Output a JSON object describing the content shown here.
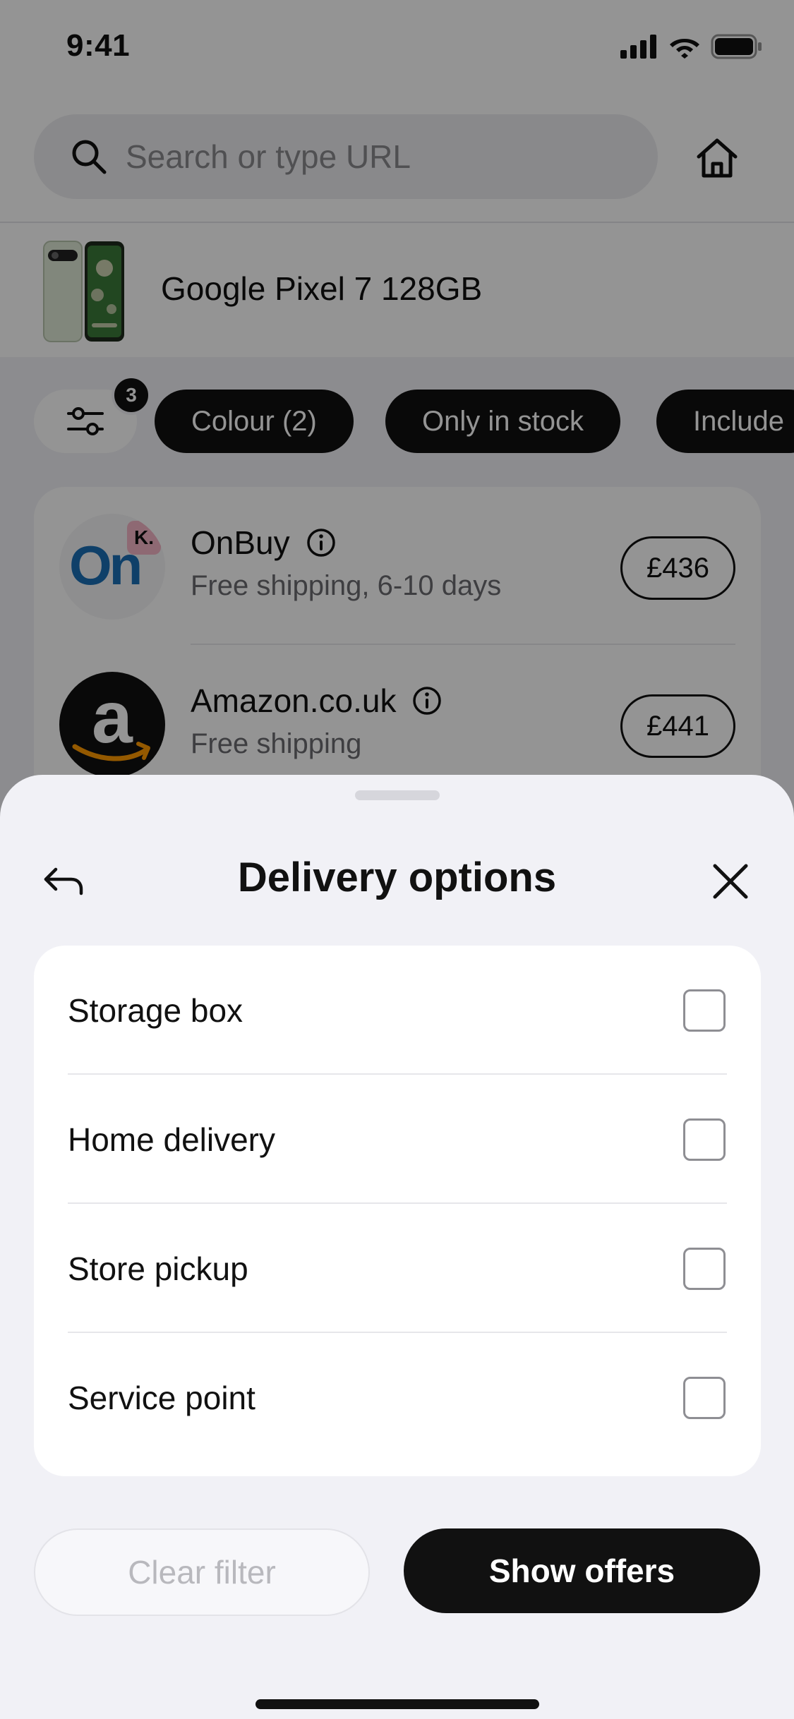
{
  "status_bar": {
    "time": "9:41"
  },
  "search": {
    "placeholder": "Search or type URL"
  },
  "product": {
    "title": "Google Pixel 7 128GB"
  },
  "filters": {
    "badge_count": "3",
    "chips": [
      "Colour (2)",
      "Only in stock",
      "Include"
    ]
  },
  "offers": [
    {
      "store": "OnBuy",
      "shipping": "Free shipping, 6-10 days",
      "price": "£436",
      "logo_text": "On",
      "logo_badge": "K."
    },
    {
      "store": "Amazon.co.uk",
      "shipping": "Free shipping",
      "price": "£441",
      "logo_text": "a"
    }
  ],
  "sheet": {
    "title": "Delivery options",
    "options": [
      "Storage box",
      "Home delivery",
      "Store pickup",
      "Service point"
    ],
    "clear_label": "Clear filter",
    "show_label": "Show offers"
  },
  "colors": {
    "accent": "#111111",
    "sheet_bg": "#f1f1f6",
    "amazon_orange": "#ff9900",
    "onbuy_blue": "#1a6fb5"
  }
}
